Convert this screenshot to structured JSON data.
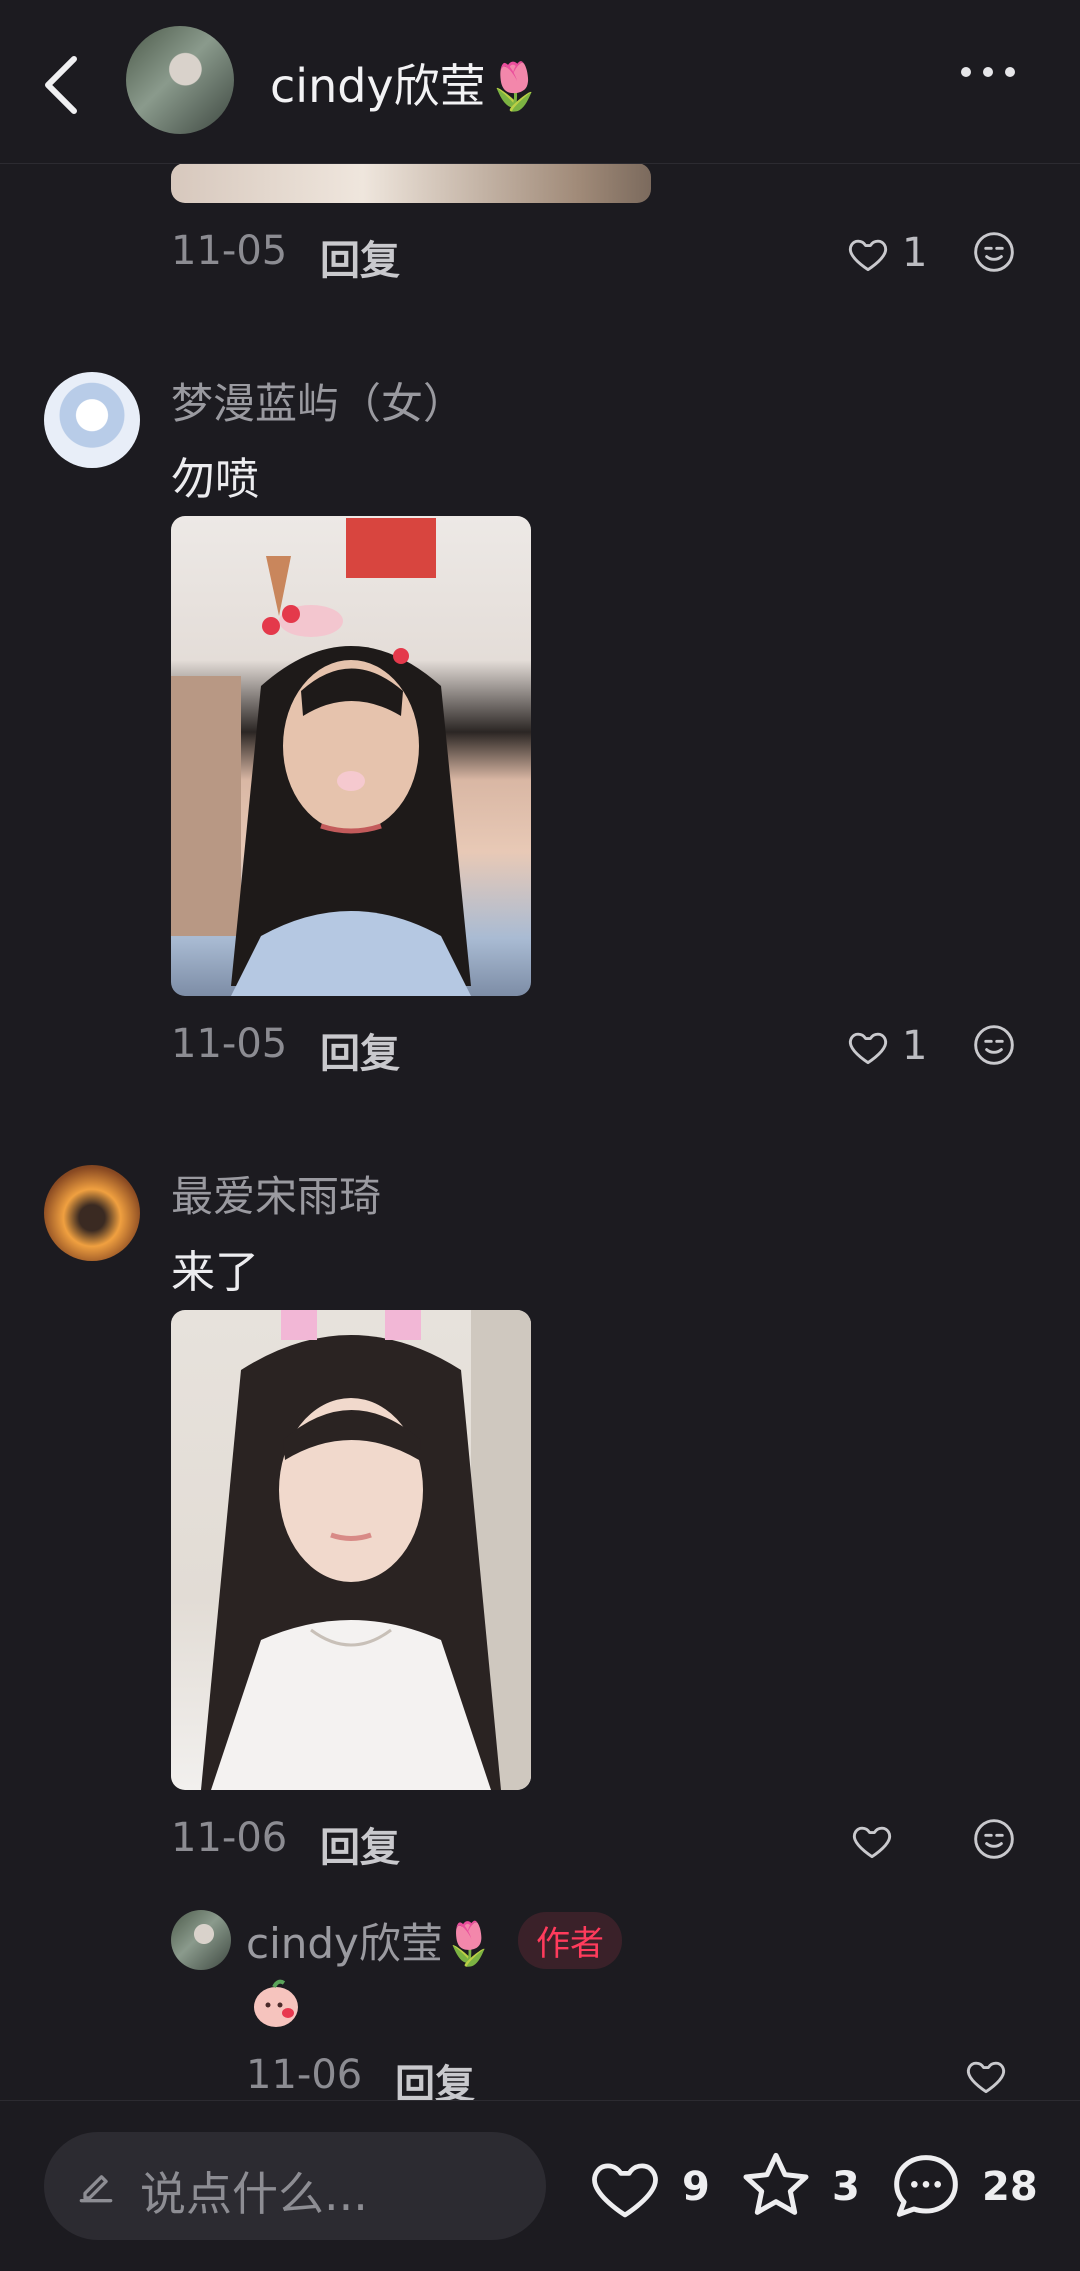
{
  "header": {
    "title": "cindy欣莹",
    "title_emoji": "🌷"
  },
  "comments": [
    {
      "date": "11-05",
      "reply_label": "回复",
      "likes": "1"
    },
    {
      "username": "梦漫蓝屿（女）",
      "text": "勿喷",
      "date": "11-05",
      "reply_label": "回复",
      "likes": "1"
    },
    {
      "username": "最爱宋雨琦",
      "text": "来了",
      "date": "11-06",
      "reply_label": "回复",
      "likes": ""
    }
  ],
  "author_reply": {
    "username": "cindy欣莹",
    "username_emoji": "🌷",
    "badge": "作者",
    "date": "11-06",
    "reply_label": "回复"
  },
  "bottom_bar": {
    "input_placeholder": "说点什么...",
    "like_count": "9",
    "star_count": "3",
    "comment_count": "28"
  },
  "colors": {
    "background": "#1c1b20",
    "author_badge": "#ff3b5c",
    "input_bg": "#2c2b31"
  }
}
